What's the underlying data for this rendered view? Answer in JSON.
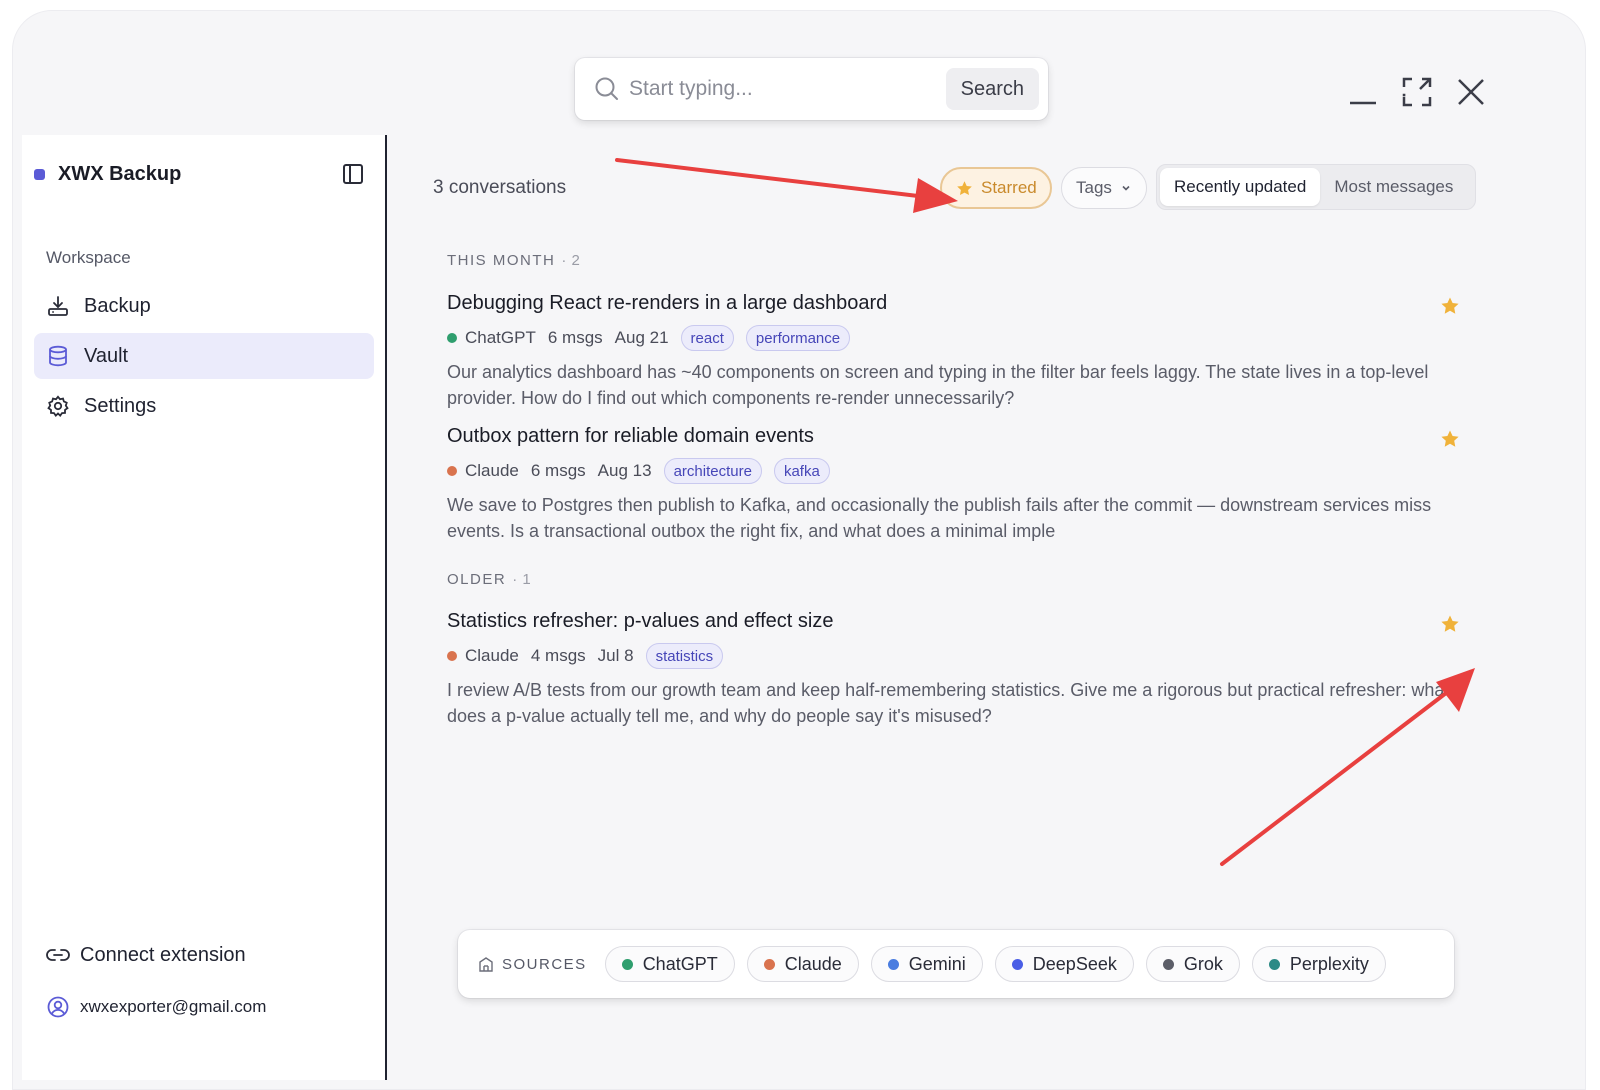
{
  "search": {
    "placeholder": "Start typing...",
    "button_label": "Search"
  },
  "sidebar": {
    "brand": "XWX Backup",
    "workspace_label": "Workspace",
    "items": [
      {
        "label": "Backup",
        "icon": "download-tray-icon"
      },
      {
        "label": "Vault",
        "icon": "database-icon",
        "active": true
      },
      {
        "label": "Settings",
        "icon": "gear-icon"
      }
    ],
    "connect_label": "Connect extension",
    "email": "xwxexporter@gmail.com"
  },
  "main": {
    "count_label": "3 conversations",
    "filters": {
      "starred_label": "Starred",
      "tags_label": "Tags"
    },
    "sort": {
      "recent_label": "Recently updated",
      "most_label": "Most messages",
      "selected": "Recently updated"
    },
    "sections": [
      {
        "label": "THIS MONTH",
        "count": "· 2",
        "conversations": [
          {
            "title": "Debugging React re-renders in a large dashboard",
            "source": "ChatGPT",
            "msgs": "6 msgs",
            "date": "Aug 21",
            "tags": [
              "react",
              "performance"
            ],
            "snippet": "Our analytics dashboard has ~40 components on screen and typing in the filter bar feels laggy. The state lives in a top-level provider. How do I find out which components re-render unnecessarily?",
            "starred": true
          },
          {
            "title": "Outbox pattern for reliable domain events",
            "source": "Claude",
            "msgs": "6 msgs",
            "date": "Aug 13",
            "tags": [
              "architecture",
              "kafka"
            ],
            "snippet": "We save to Postgres then publish to Kafka, and occasionally the publish fails after the commit — downstream services miss events. Is a transactional outbox the right fix, and what does a minimal imple",
            "starred": true
          }
        ]
      },
      {
        "label": "OLDER",
        "count": "· 1",
        "conversations": [
          {
            "title": "Statistics refresher: p-values and effect size",
            "source": "Claude",
            "msgs": "4 msgs",
            "date": "Jul 8",
            "tags": [
              "statistics"
            ],
            "snippet": "I review A/B tests from our growth team and keep half-remembering statistics. Give me a rigorous but practical refresher: what does a p-value actually tell me, and why do people say it's misused?",
            "starred": true
          }
        ]
      }
    ]
  },
  "sources": {
    "label": "SOURCES",
    "chips": [
      {
        "name": "ChatGPT",
        "color": "#2f9e6e"
      },
      {
        "name": "Claude",
        "color": "#d9734e"
      },
      {
        "name": "Gemini",
        "color": "#4a7de0"
      },
      {
        "name": "DeepSeek",
        "color": "#4a5ee6"
      },
      {
        "name": "Grok",
        "color": "#5c5e68"
      },
      {
        "name": "Perplexity",
        "color": "#2d8a86"
      }
    ]
  },
  "colors": {
    "accent": "#5b5bd6",
    "star": "#f0b23a",
    "arrow": "#e8403f"
  }
}
